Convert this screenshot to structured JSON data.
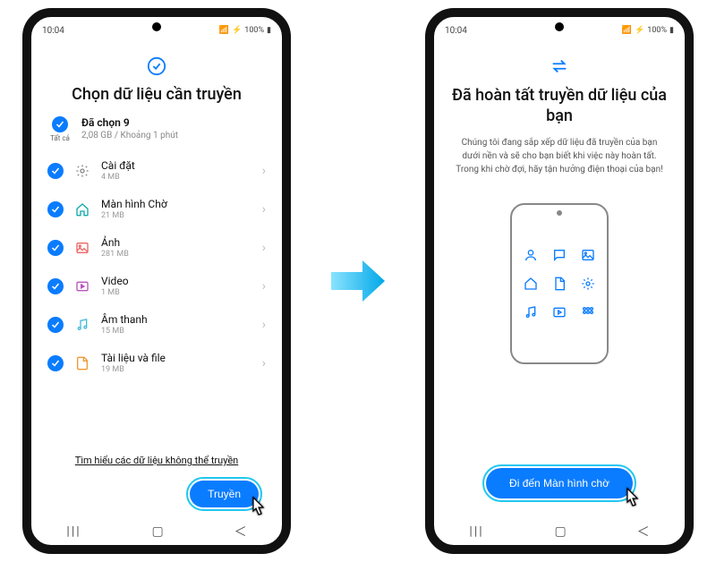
{
  "statusbar": {
    "time": "10:04",
    "left_icons": "✉ ⬚ ☁",
    "right_icons": "📶 ⚡ 100%🔋",
    "right_text": "100%"
  },
  "screen1": {
    "title": "Chọn dữ liệu cần truyền",
    "select_all_label": "Tất cả",
    "summary_title": "Đã chọn 9",
    "summary_sub": "2,08 GB / Khoảng 1 phút",
    "items": [
      {
        "title": "Cài đặt",
        "sub": "4 MB",
        "icon": "gear"
      },
      {
        "title": "Màn hình Chờ",
        "sub": "21 MB",
        "icon": "home"
      },
      {
        "title": "Ảnh",
        "sub": "281 MB",
        "icon": "image"
      },
      {
        "title": "Video",
        "sub": "1 MB",
        "icon": "video"
      },
      {
        "title": "Âm thanh",
        "sub": "15 MB",
        "icon": "music"
      },
      {
        "title": "Tài liệu và file",
        "sub": "19 MB",
        "icon": "document"
      }
    ],
    "learn_link": "Tìm hiểu các dữ liệu không thể truyền",
    "transfer_btn": "Truyền"
  },
  "screen2": {
    "title": "Đã hoàn tất truyền dữ liệu của bạn",
    "desc": "Chúng tôi đang sắp xếp dữ liệu đã truyền của bạn dưới nền và sẽ cho bạn biết khi việc này hoàn tất. Trong khi chờ đợi, hãy tận hưởng điện thoại của bạn!",
    "goto_btn": "Đi đến Màn hình chờ"
  },
  "navbar": {
    "recents": "|||",
    "home": "◯",
    "back": "‹"
  }
}
